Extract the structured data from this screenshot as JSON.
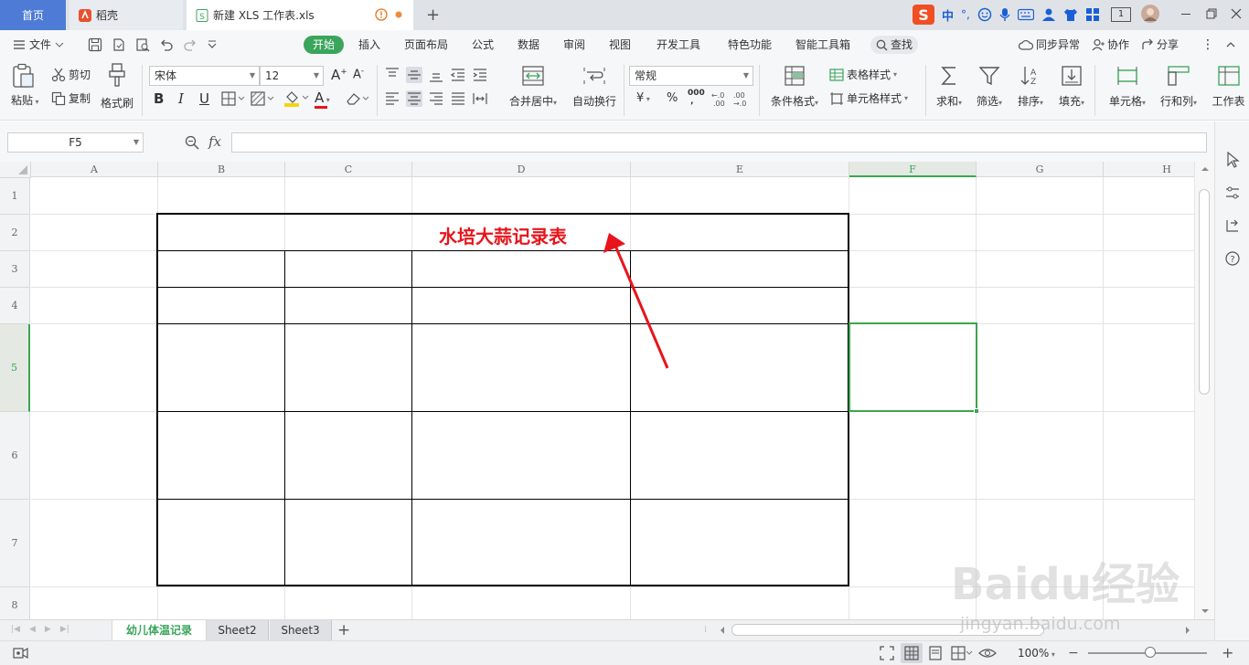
{
  "window": {
    "tabs": [
      {
        "label": "首页"
      },
      {
        "label": "稻壳"
      },
      {
        "label": "新建 XLS 工作表.xls"
      }
    ],
    "right_badge": "1",
    "ime_label": "中"
  },
  "menu": {
    "file": "文件",
    "items": [
      "开始",
      "插入",
      "页面布局",
      "公式",
      "数据",
      "审阅",
      "视图",
      "开发工具",
      "特色功能",
      "智能工具箱"
    ],
    "search": "查找",
    "sync": "同步异常",
    "collab": "协作",
    "share": "分享"
  },
  "toolbar": {
    "paste": "粘贴",
    "cut": "剪切",
    "copy": "复制",
    "format_painter": "格式刷",
    "font_name": "宋体",
    "font_size": "12",
    "merge_center": "合并居中",
    "wrap_text": "自动换行",
    "number_format": "常规",
    "conditional_format": "条件格式",
    "table_style": "表格样式",
    "cell_style": "单元格样式",
    "sum": "求和",
    "filter": "筛选",
    "sort": "排序",
    "fill": "填充",
    "cell": "单元格",
    "row_col": "行和列",
    "worksheet": "工作表",
    "bold": "B",
    "italic": "I",
    "underline": "U",
    "font_color_letter": "A",
    "currency": "¥",
    "percent": "%",
    "thousands": "000"
  },
  "formula_bar": {
    "name_box": "F5",
    "fx": "fx",
    "value": ""
  },
  "grid": {
    "columns": [
      "A",
      "B",
      "C",
      "D",
      "E",
      "F",
      "G",
      "H"
    ],
    "rows": [
      "1",
      "2",
      "3",
      "4",
      "5",
      "6",
      "7",
      "8"
    ],
    "selected_cell": "F5",
    "table_title": "水培大蒜记录表"
  },
  "sheets": {
    "tabs": [
      "幼儿体温记录",
      "Sheet2",
      "Sheet3"
    ],
    "active": "幼儿体温记录"
  },
  "status": {
    "zoom": "100%"
  },
  "watermark": {
    "brand": "Baidu经验",
    "url": "jingyan.baidu.com"
  },
  "colors": {
    "accent_green": "#3aa55b",
    "home_tab_blue": "#4d7bd6",
    "title_red": "#e8141b",
    "selection_green": "#3ca550"
  }
}
